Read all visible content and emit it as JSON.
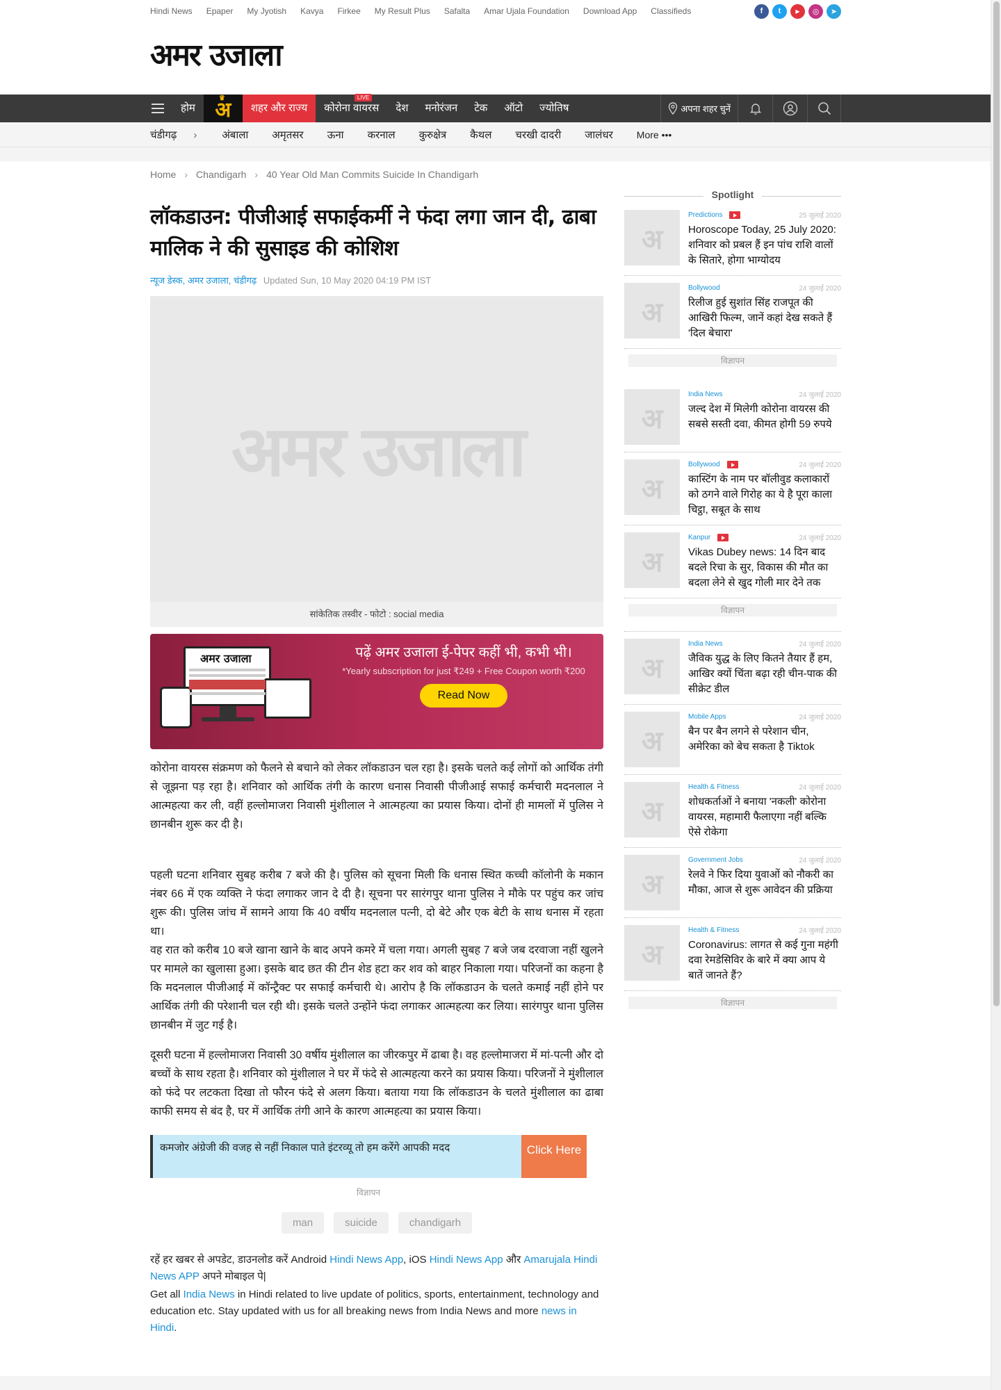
{
  "topbar": {
    "links": [
      "Hindi News",
      "Epaper",
      "My Jyotish",
      "Kavya",
      "Firkee",
      "My Result Plus",
      "Safalta",
      "Amar Ujala Foundation",
      "Download App",
      "Classifieds"
    ],
    "socials": [
      {
        "icon": "facebook-icon",
        "glyph": "f",
        "color": "#3b5998"
      },
      {
        "icon": "twitter-icon",
        "glyph": "t",
        "color": "#1da1f2"
      },
      {
        "icon": "youtube-icon",
        "glyph": "▶",
        "color": "#e2333c"
      },
      {
        "icon": "instagram-icon",
        "glyph": "◎",
        "color": "#c13584"
      },
      {
        "icon": "telegram-icon",
        "glyph": "➤",
        "color": "#2aa3df"
      }
    ]
  },
  "logo": "अमर उजाला",
  "nav": {
    "home": "होम",
    "badge": "अ",
    "city_state": "शहर और राज्य",
    "corona": "कोरोना वायरस",
    "live": "LIVE",
    "items": [
      "देश",
      "मनोरंजन",
      "टेक",
      "ऑटो",
      "ज्योतिष"
    ],
    "city_picker": "अपना शहर चुनें"
  },
  "citynav": {
    "current": "चंडीगढ़",
    "arrow": "›",
    "cities": [
      "अंबाला",
      "अमृतसर",
      "ऊना",
      "करनाल",
      "कुरुक्षेत्र",
      "कैथल",
      "चरखी दादरी",
      "जालंधर"
    ],
    "more": "More •••"
  },
  "breadcrumb": {
    "home": "Home",
    "section": "Chandigarh",
    "current": "40 Year Old Man Commits Suicide In Chandigarh",
    "sep": "›"
  },
  "article": {
    "title": "लॉकडाउन: पीजीआई सफाईकर्मी ने फंदा लगा जान दी, ढाबा मालिक ने की सुसाइड की कोशिश",
    "byline": "न्यूज डेस्क, अमर उजाला, चंडीगढ़",
    "updated": "Updated Sun, 10 May 2020 04:19 PM IST",
    "hero_watermark": "अमर उजाला",
    "caption": "सांकेतिक तस्वीर - फोटो : social media",
    "paragraphs": [
      "कोरोना वायरस संक्रमण को फैलने से बचाने को लेकर लॉकडाउन चल रहा है। इसके चलते कई लोगों को आर्थिक तंगी से जूझना पड़ रहा है। शनिवार को आर्थिक तंगी के कारण धनास निवासी पीजीआई सफाई कर्मचारी मदनलाल ने आत्महत्या कर ली, वहीं हल्लोमाजरा निवासी मुंशीलाल ने आत्महत्या का प्रयास किया। दोनों ही मामलों में पुलिस ने छानबीन शुरू कर दी है।",
      "पहली घटना शनिवार सुबह करीब 7 बजे की है। पुलिस को सूचना मिली कि धनास स्थित कच्ची कॉलोनी के मकान नंबर 66 में एक व्यक्ति ने फंदा लगाकर जान दे दी है। सूचना पर सारंगपुर थाना पुलिस ने मौके पर पहुंच कर जांच शुरू की। पुलिस जांच में सामने आया कि 40 वर्षीय मदनलाल पत्नी, दो बेटे और एक बेटी के साथ धनास में रहता था।",
      "वह रात को करीब 10 बजे खाना खाने के बाद अपने कमरे में चला गया। अगली सुबह 7 बजे जब दरवाजा नहीं खुलने पर मामले का खुलासा हुआ। इसके बाद छत की टीन शेड हटा कर शव को बाहर निकाला गया। परिजनों का कहना है कि मदनलाल पीजीआई में कॉन्ट्रैक्ट पर सफाई कर्मचारी थे। आरोप है कि लॉकडाउन के चलते कमाई नहीं होने पर आर्थिक तंगी की परेशानी चल रही थी। इसके चलते उन्होंने फंदा लगाकर आत्महत्या कर लिया। सारंगपुर थाना पुलिस छानबीन में जुट गई है।",
      "दूसरी घटना में हल्लोमाजरा निवासी 30 वर्षीय मुंशीलाल का जीरकपुर में ढाबा है। वह हल्लोमाजरा में मां-पत्नी और दो बच्चों के साथ रहता है। शनिवार को मुंशीलाल ने घर में फंदे से आत्महत्या करने का प्रयास किया। परिजनों ने मुंशीलाल को फंदे पर लटकता दिखा तो फौरन फंदे से अलग किया। बताया गया कि लॉकडाउन के चलते मुंशीलाल का ढाबा काफी समय से बंद है, घर में आर्थिक तंगी आने के कारण आत्महत्या का प्रयास किया।"
    ]
  },
  "promo": {
    "heading": "पढ़ें अमर उजाला ई-पेपर कहीं भी, कभी भी।",
    "sub": "*Yearly subscription for just ₹249 + Free Coupon worth ₹200",
    "button": "Read Now",
    "device_logo": "अमर उजाला"
  },
  "cta": {
    "text": "कमजोर अंग्रेजी की वजह से नहीं निकाल पाते इंटरव्यू तो हम करेंगे आपकी मदद",
    "button": "Click Here"
  },
  "ad_label": "विज्ञापन",
  "tags": [
    "man",
    "suicide",
    "chandigarh"
  ],
  "footer": {
    "line1_a": "रहें हर खबर से अपडेट, डाउनलोड करें Android ",
    "line1_link1": "Hindi News App",
    "line1_b": ", iOS ",
    "line1_link2": "Hindi News App",
    "line1_c": " और ",
    "line1_link3": "Amarujala Hindi News APP",
    "line1_d": " अपने मोबाइल पे|",
    "line2_a": "Get all ",
    "line2_link1": "India News",
    "line2_b": " in Hindi related to live update of politics, sports, entertainment, technology and education etc. Stay updated with us for all breaking news from India News and more ",
    "line2_link2": "news in Hindi",
    "line2_c": "."
  },
  "sidebar": {
    "heading": "Spotlight",
    "thumb_glyph": "अ",
    "ad_label": "विज्ञापन",
    "cards": [
      {
        "category": "Predictions",
        "video": true,
        "date": "25 जुलाई 2020",
        "title": "Horoscope Today, 25 July 2020: शनिवार को प्रबल हैं इन पांच राशि वालों के सितारे, होगा भाग्योदय"
      },
      {
        "category": "Bollywood",
        "video": false,
        "date": "24 जुलाई 2020",
        "title": "रिलीज हुई सुशांत सिंह राजपूत की आखिरी फिल्म, जानें कहां देख सकते हैं 'दिल बेचारा'"
      },
      {
        "category": "India News",
        "video": false,
        "date": "24 जुलाई 2020",
        "title": "जल्द देश में मिलेगी कोरोना वायरस की सबसे सस्ती दवा, कीमत होगी 59 रुपये"
      },
      {
        "category": "Bollywood",
        "video": true,
        "date": "24 जुलाई 2020",
        "title": "कास्टिंग के नाम पर बॉलीवुड कलाकारों को ठगने वाले गिरोह का ये है पूरा काला चिट्ठा, सबूत के साथ"
      },
      {
        "category": "Kanpur",
        "video": true,
        "date": "24 जुलाई 2020",
        "title": "Vikas Dubey news: 14 दिन बाद बदले रिचा के सुर, विकास की मौत का बदला लेने से खुद गोली मार देने तक"
      },
      {
        "category": "India News",
        "video": false,
        "date": "24 जुलाई 2020",
        "title": "जैविक युद्ध के लिए कितने तैयार हैं हम, आखिर क्यों चिंता बढ़ा रही चीन-पाक की सीक्रेट डील"
      },
      {
        "category": "Mobile Apps",
        "video": false,
        "date": "24 जुलाई 2020",
        "title": "बैन पर बैन लगने से परेशान चीन, अमेरिका को बेच सकता है Tiktok"
      },
      {
        "category": "Health & Fitness",
        "video": false,
        "date": "24 जुलाई 2020",
        "title": "शोधकर्ताओं ने बनाया 'नकली' कोरोना वायरस, महामारी फैलाएगा नहीं बल्कि ऐसे रोकेगा"
      },
      {
        "category": "Government Jobs",
        "video": false,
        "date": "24 जुलाई 2020",
        "title": "रेलवे ने फिर दिया युवाओं को नौकरी का मौका, आज से शुरू आवेदन की प्रक्रिया"
      },
      {
        "category": "Health & Fitness",
        "video": false,
        "date": "24 जुलाई 2020",
        "title": "Coronavirus: लागत से कई गुना महंगी दवा रेमडेसिविर के बारे में क्या आप ये बातें जानते हैं?"
      }
    ]
  }
}
